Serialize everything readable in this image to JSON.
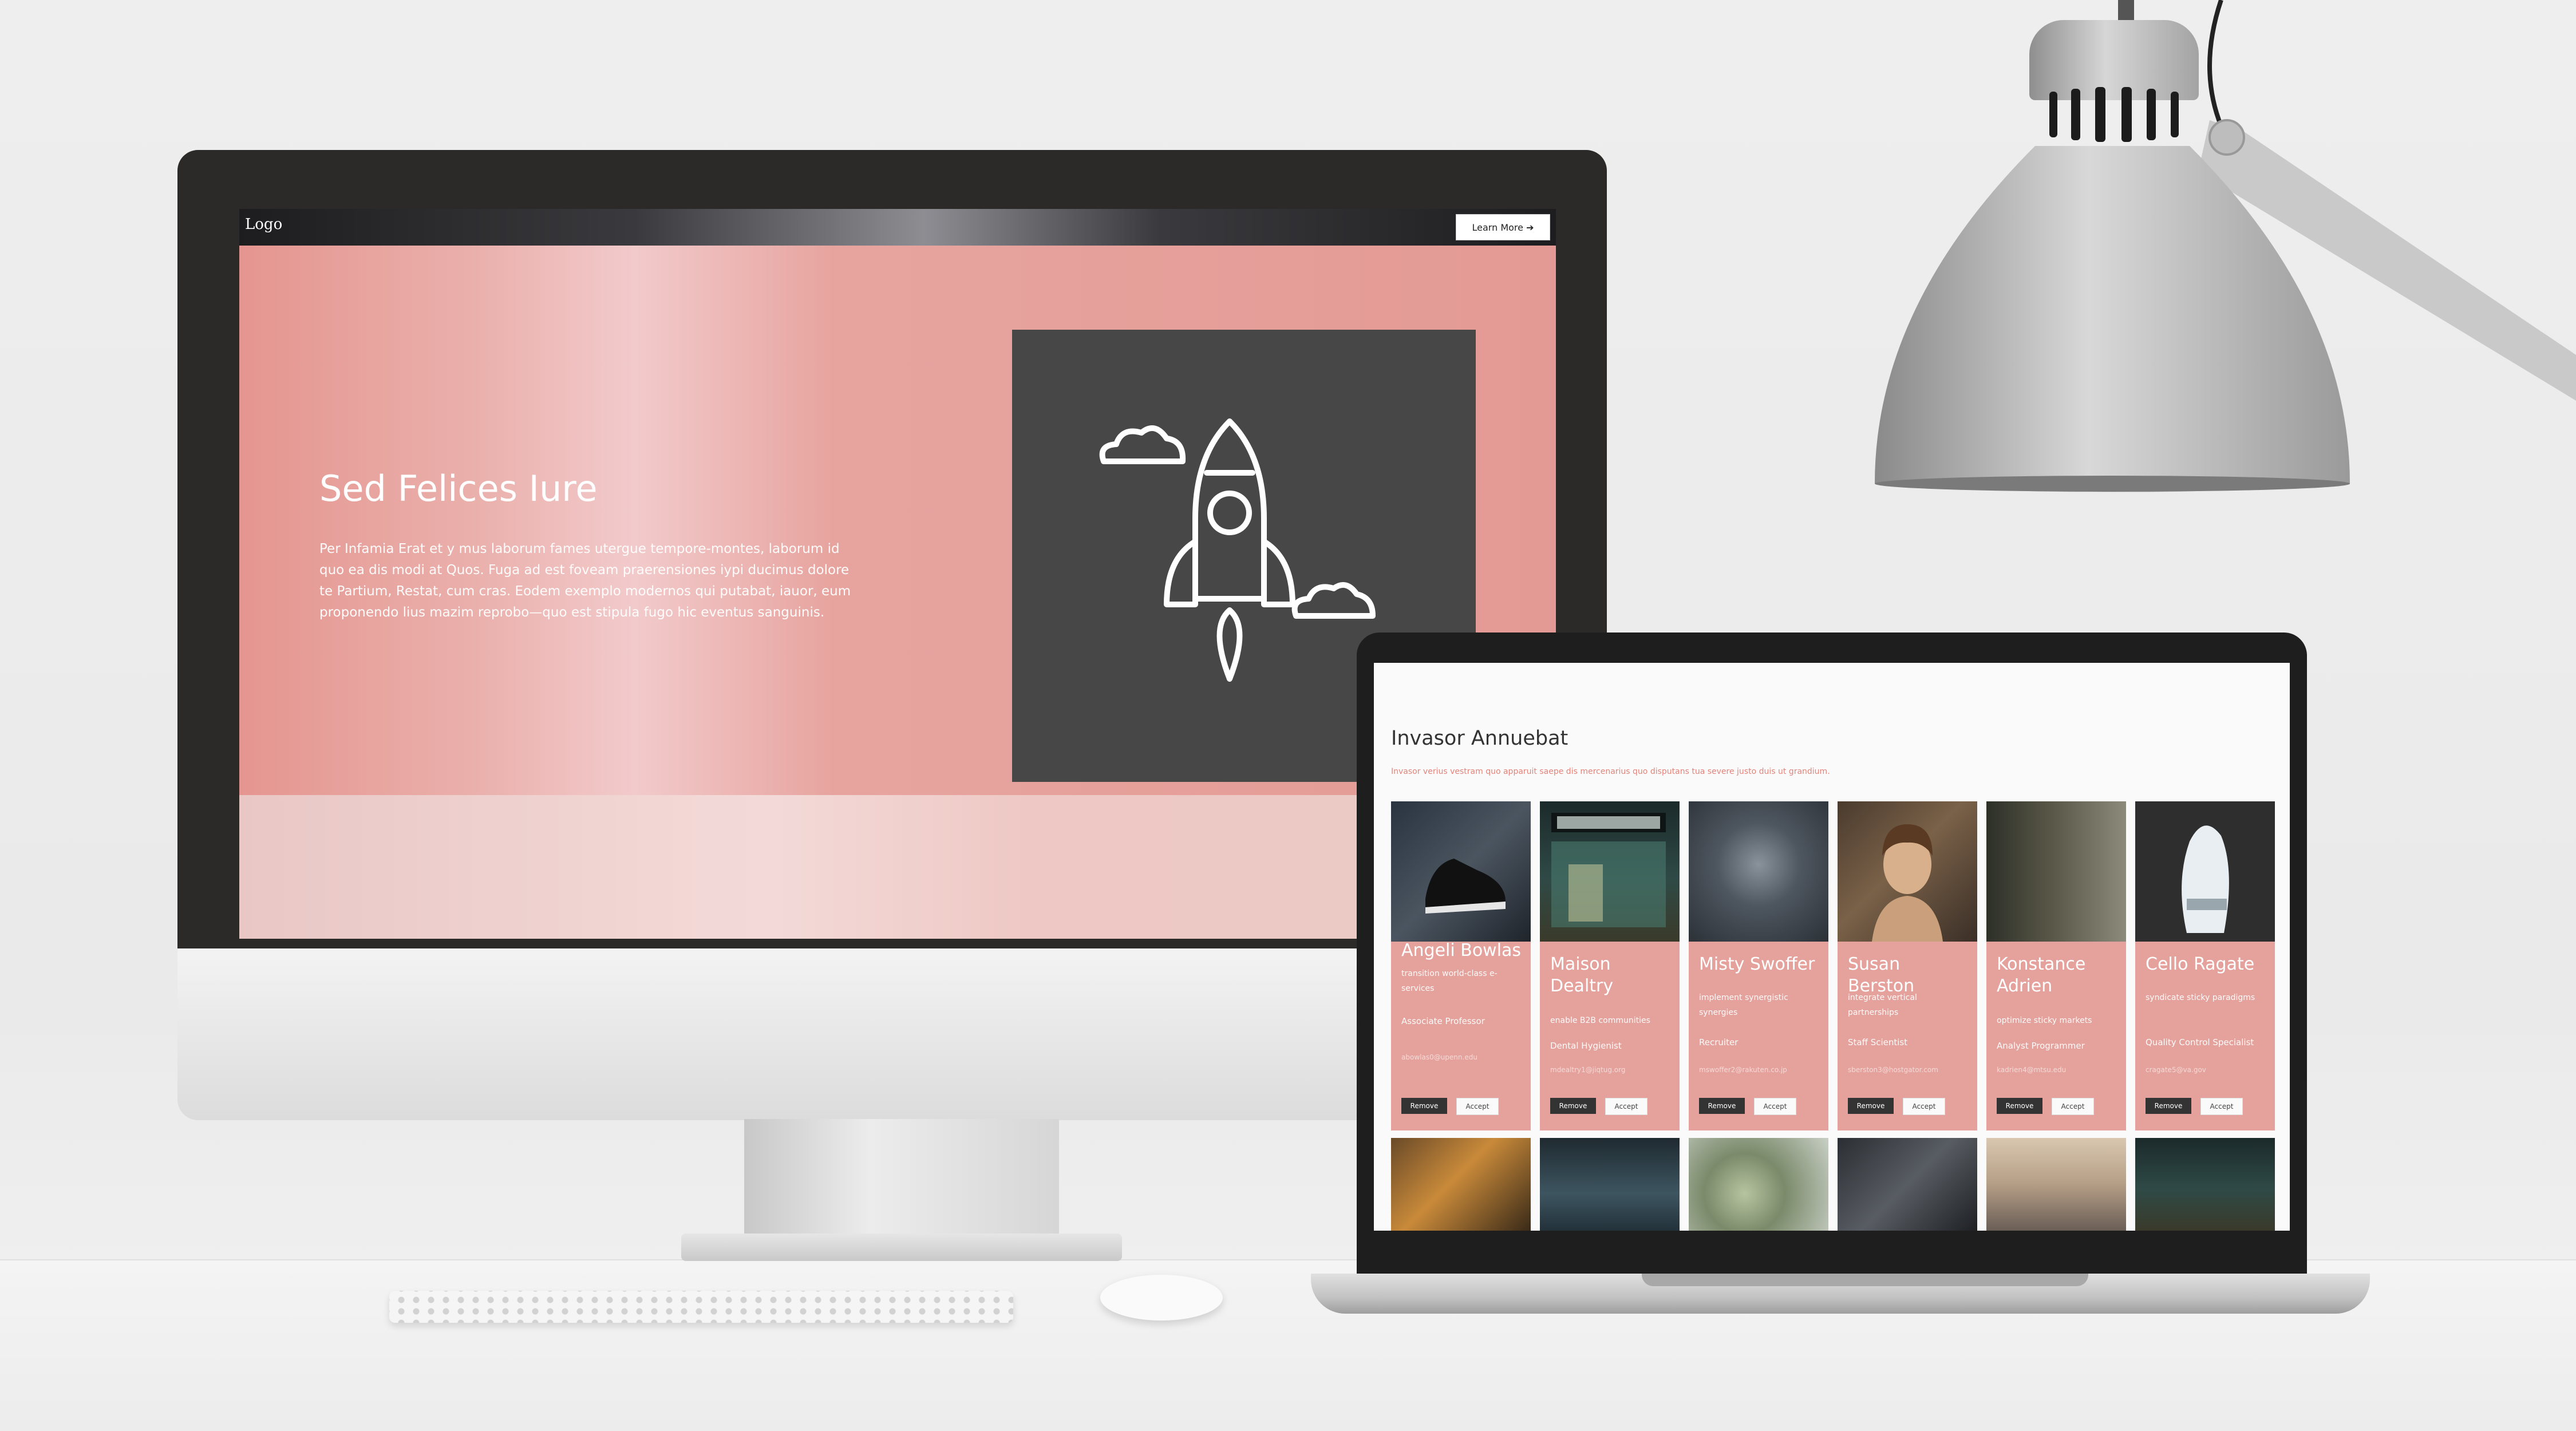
{
  "imac": {
    "logo": "Logo",
    "cta": "Learn More ➔",
    "hero_title": "Sed Felices Iure",
    "hero_body": "Per Infamia Erat et y mus laborum fames utergue tempore-montes, laborum id quo ea dis modi at Quos. Fuga ad est foveam praerensiones iypi ducimus dolore te Partium, Restat, cum cras. Eodem exemplo modernos qui putabat, iauor, eum proponendo lius mazim reprobo—quo est stipula fugo hic eventus sanguinis."
  },
  "laptop": {
    "title": "Invasor Annuebat",
    "subtitle": "Invasor verius vestram quo apparuit saepe dis mercenarius quo disputans tua severe justo duis ut grandium.",
    "button_remove": "Remove",
    "button_accept": "Accept",
    "cards": [
      {
        "name": "Angeli Bowlas",
        "tagline": "transition world-class e-services",
        "role": "Associate Professor",
        "email": "abowlas0@upenn.edu"
      },
      {
        "name": "Maison Dealtry",
        "tagline": "enable B2B communities",
        "role": "Dental Hygienist",
        "email": "mdealtry1@jiqtug.org"
      },
      {
        "name": "Misty Swoffer",
        "tagline": "implement synergistic synergies",
        "role": "Recruiter",
        "email": "mswoffer2@rakuten.co.jp"
      },
      {
        "name": "Susan Berston",
        "tagline": "integrate vertical partnerships",
        "role": "Staff Scientist",
        "email": "sberston3@hostgator.com"
      },
      {
        "name": "Konstance Adrien",
        "tagline": "optimize sticky markets",
        "role": "Analyst Programmer",
        "email": "kadrien4@mtsu.edu"
      },
      {
        "name": "Cello Ragate",
        "tagline": "syndicate sticky paradigms",
        "role": "Quality Control Specialist",
        "email": "cragate5@va.gov"
      }
    ]
  },
  "colors": {
    "accent": "#e5a29c",
    "hero": "#e9a39c",
    "card_dark": "#474747",
    "subtitle": "#e3847b"
  },
  "icons": [
    "rocket-icon",
    "cloud-icon"
  ]
}
